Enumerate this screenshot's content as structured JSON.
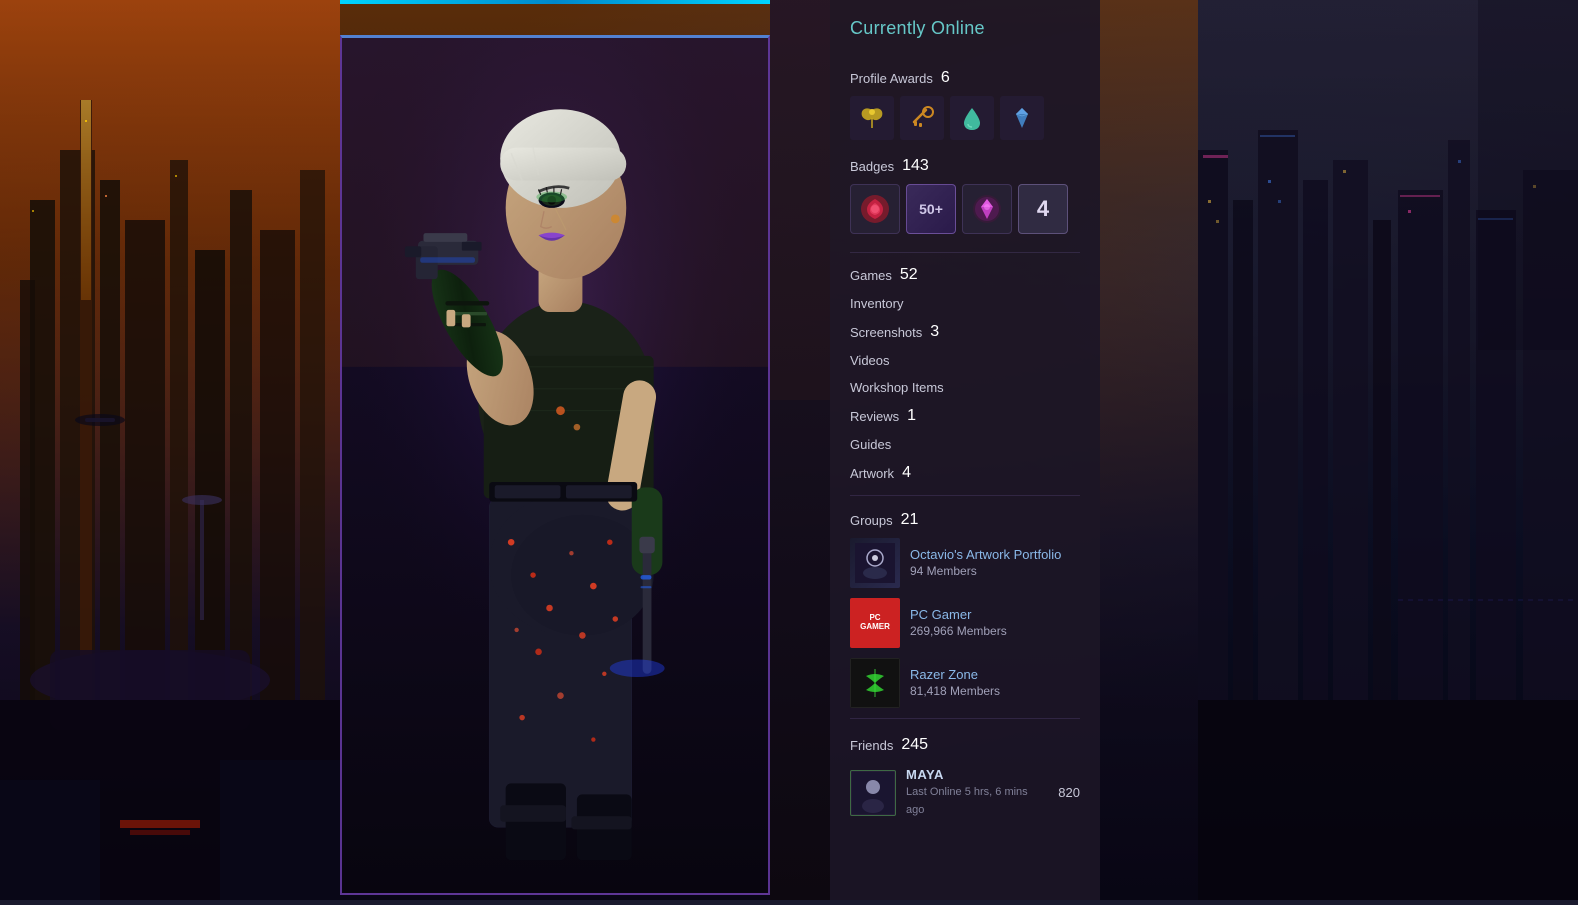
{
  "status": {
    "online_label": "Currently Online"
  },
  "profile_awards": {
    "label": "Profile Awards",
    "count": "6",
    "icons": [
      "🦋",
      "🔑",
      "💧",
      "🔵"
    ]
  },
  "badges": {
    "label": "Badges",
    "count": "143",
    "items": [
      {
        "type": "rose",
        "symbol": "🌹"
      },
      {
        "type": "level",
        "text": "50+"
      },
      {
        "type": "gem",
        "symbol": "💎"
      },
      {
        "type": "number",
        "text": "4"
      }
    ]
  },
  "games": {
    "label": "Games",
    "count": "52"
  },
  "inventory": {
    "label": "Inventory",
    "count": ""
  },
  "screenshots": {
    "label": "Screenshots",
    "count": "3"
  },
  "videos": {
    "label": "Videos",
    "count": ""
  },
  "workshop_items": {
    "label": "Workshop Items",
    "count": ""
  },
  "reviews": {
    "label": "Reviews",
    "count": "1"
  },
  "guides": {
    "label": "Guides",
    "count": ""
  },
  "artwork": {
    "label": "Artwork",
    "count": "4"
  },
  "groups": {
    "label": "Groups",
    "count": "21",
    "items": [
      {
        "name": "Octavio's Artwork Portfolio",
        "members": "94 Members",
        "type": "octavio"
      },
      {
        "name": "PC Gamer",
        "members": "269,966 Members",
        "type": "pcgamer"
      },
      {
        "name": "Razer Zone",
        "members": "81,418 Members",
        "type": "razer"
      }
    ]
  },
  "friends": {
    "label": "Friends",
    "count": "245",
    "items": [
      {
        "name": "MAYA",
        "status": "Last Online 5 hrs, 6 mins ago",
        "score": "820"
      }
    ]
  }
}
